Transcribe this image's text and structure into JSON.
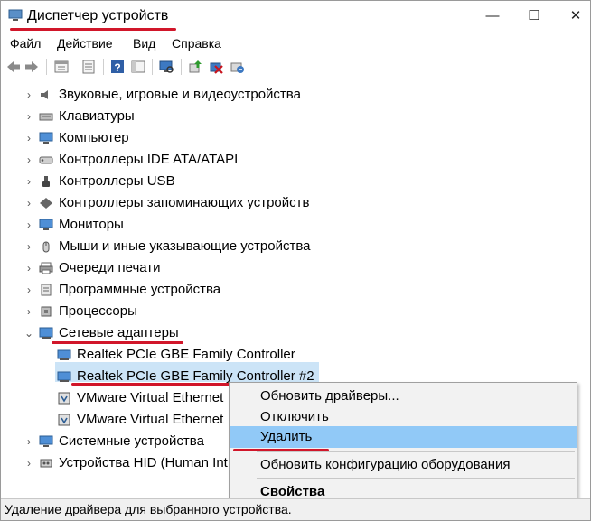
{
  "window": {
    "title": "Диспетчер устройств",
    "minimize": "—",
    "maximize": "☐",
    "close": "✕"
  },
  "menu": [
    "Файл",
    "Действие",
    "Вид",
    "Справка"
  ],
  "toolbar_icons": [
    "back-arrow-icon",
    "forward-arrow-icon",
    "properties-view-icon",
    "list-view-icon",
    "help-icon",
    "console-tree-icon",
    "monitor-scan-icon",
    "update-driver-icon",
    "disable-device-icon",
    "uninstall-device-icon"
  ],
  "tree": [
    {
      "label": "Звуковые, игровые и видеоустройства",
      "icon": "speaker-icon",
      "expanded": false,
      "indent": 0
    },
    {
      "label": "Клавиатуры",
      "icon": "keyboard-icon",
      "expanded": false,
      "indent": 0
    },
    {
      "label": "Компьютер",
      "icon": "computer-icon",
      "expanded": false,
      "indent": 0
    },
    {
      "label": "Контроллеры IDE ATA/ATAPI",
      "icon": "ide-controller-icon",
      "expanded": false,
      "indent": 0
    },
    {
      "label": "Контроллеры USB",
      "icon": "usb-icon",
      "expanded": false,
      "indent": 0
    },
    {
      "label": "Контроллеры запоминающих устройств",
      "icon": "storage-controller-icon",
      "expanded": false,
      "indent": 0
    },
    {
      "label": "Мониторы",
      "icon": "monitor-icon",
      "expanded": false,
      "indent": 0
    },
    {
      "label": "Мыши и иные указывающие устройства",
      "icon": "mouse-icon",
      "expanded": false,
      "indent": 0
    },
    {
      "label": "Очереди печати",
      "icon": "printer-icon",
      "expanded": false,
      "indent": 0
    },
    {
      "label": "Программные устройства",
      "icon": "software-device-icon",
      "expanded": false,
      "indent": 0
    },
    {
      "label": "Процессоры",
      "icon": "processor-icon",
      "expanded": false,
      "indent": 0
    },
    {
      "label": "Сетевые адаптеры",
      "icon": "network-adapter-icon",
      "expanded": true,
      "indent": 0
    },
    {
      "label": "Realtek PCIe GBE Family Controller",
      "icon": "network-card-icon",
      "indent": 1
    },
    {
      "label": "Realtek PCIe GBE Family Controller #2",
      "icon": "network-card-icon",
      "indent": 1,
      "selected": true
    },
    {
      "label": "VMware Virtual Ethernet",
      "icon": "virtual-network-icon",
      "indent": 1
    },
    {
      "label": "VMware Virtual Ethernet",
      "icon": "virtual-network-icon",
      "indent": 1
    },
    {
      "label": "Системные устройства",
      "icon": "system-device-icon",
      "expanded": false,
      "indent": 0
    },
    {
      "label": "Устройства HID (Human Int",
      "icon": "hid-icon",
      "expanded": false,
      "indent": 0
    }
  ],
  "context_menu": [
    {
      "label": "Обновить драйверы...",
      "highlighted": false,
      "bold": false
    },
    {
      "label": "Отключить",
      "highlighted": false,
      "bold": false
    },
    {
      "label": "Удалить",
      "highlighted": true,
      "bold": false
    },
    {
      "label": "Обновить конфигурацию оборудования",
      "highlighted": false,
      "bold": false
    },
    {
      "label": "Свойства",
      "highlighted": false,
      "bold": true
    }
  ],
  "status": "Удаление драйвера для выбранного устройства.",
  "colors": {
    "annotation": "#d1162a",
    "selection": "#cce4f7",
    "menu_highlight": "#91c9f7"
  }
}
